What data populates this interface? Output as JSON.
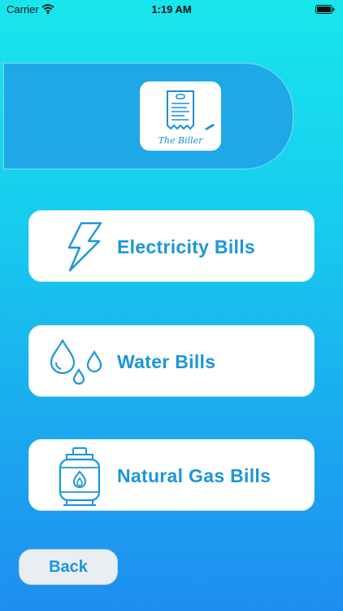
{
  "status_bar": {
    "carrier": "Carrier",
    "time": "1:19 AM"
  },
  "logo": {
    "text": "The Biller"
  },
  "menu": {
    "items": [
      {
        "label": "Electricity Bills",
        "icon": "lightning-bolt-icon"
      },
      {
        "label": "Water Bills",
        "icon": "water-drops-icon"
      },
      {
        "label": "Natural Gas Bills",
        "icon": "gas-cylinder-icon"
      }
    ]
  },
  "back_label": "Back",
  "colors": {
    "accent": "#1b96d9",
    "banner": "#1ea8e8",
    "gradient_top": "#19e6ec",
    "gradient_bottom": "#1e8ef0"
  }
}
